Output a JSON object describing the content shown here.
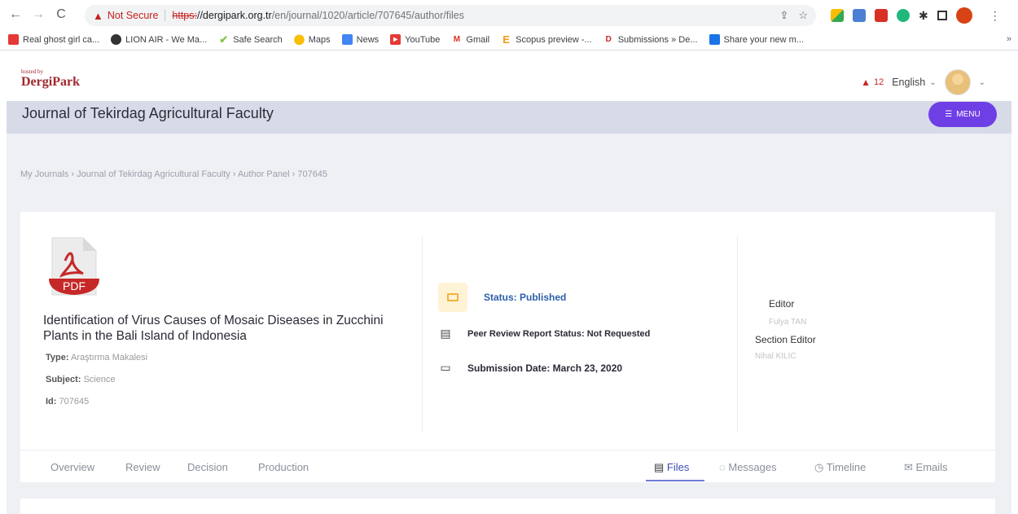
{
  "browser": {
    "not_secure_label": "Not Secure",
    "url_scheme": "https:",
    "url_host": "//dergipark.org.tr",
    "url_path": "/en/journal/1020/article/707645/author/files",
    "bookmarks": [
      {
        "label": "Real ghost girl ca...",
        "color": "#e53935"
      },
      {
        "label": "LION AIR - We Ma...",
        "color": "#333333"
      },
      {
        "label": "Safe Search",
        "color": "#8bc34a"
      },
      {
        "label": "Maps",
        "color": "#fbbc04"
      },
      {
        "label": "News",
        "color": "#4285f4"
      },
      {
        "label": "YouTube",
        "color": "#e53935"
      },
      {
        "label": "Gmail",
        "color": "#d93025"
      },
      {
        "label": "Scopus preview -...",
        "color": "#f39c12"
      },
      {
        "label": "Submissions » De...",
        "color": "#c62828"
      },
      {
        "label": "Share your new m...",
        "color": "#1a73e8"
      }
    ]
  },
  "header": {
    "logo_small": "hosted by",
    "logo_main": "DergiPark",
    "notification_count": "12",
    "language": "English"
  },
  "journal": {
    "title": "Journal of Tekirdag Agricultural Faculty",
    "menu_label": "MENU"
  },
  "breadcrumb": "My Journals › Journal of Tekirdag Agricultural Faculty › Author Panel › 707645",
  "article": {
    "pdf_label": "PDF",
    "title": "Identification of Virus Causes of Mosaic Diseases in Zucchini Plants in the Bali Island of Indonesia",
    "type_label": "Type:",
    "type_value": "Araştırma Makalesi",
    "subject_label": "Subject:",
    "subject_value": "Science",
    "id_label": "Id:",
    "id_value": "707645",
    "status": "Status: Published",
    "peer_review": "Peer Review Report Status: Not Requested",
    "submission_date": "Submission Date: March 23, 2020",
    "editor_label": "Editor",
    "editor_name": "Fulya TAN",
    "section_editor_label": "Section Editor",
    "section_editor_name": "Nihal KILIC"
  },
  "tabs_left": [
    "Overview",
    "Review",
    "Decision",
    "Production"
  ],
  "tabs_right": [
    "Files",
    "Messages",
    "Timeline",
    "Emails"
  ]
}
